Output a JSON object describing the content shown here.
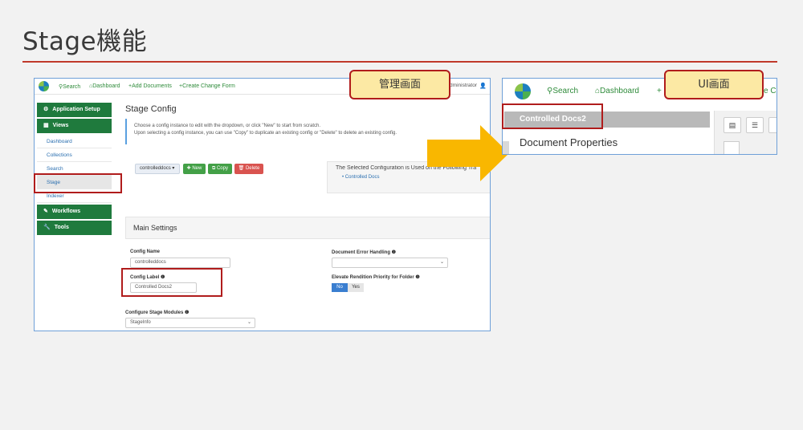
{
  "slide": {
    "title": "Stage機能"
  },
  "callouts": {
    "admin": "管理画面",
    "ui": "UI画面"
  },
  "admin_screen": {
    "nav": {
      "search": "Search",
      "dashboard": "Dashboard",
      "add_documents": "+Add Documents",
      "create_change_form": "+Create Change Form",
      "user": "administrator"
    },
    "sidebar": {
      "application_setup": "Application Setup",
      "views": "Views",
      "items": [
        "Dashboard",
        "Collections",
        "Search",
        "Stage",
        "Indexer"
      ],
      "workflows": "Workflows",
      "tools": "Tools"
    },
    "page_title": "Stage Config",
    "info_line1": "Choose a config instance to edit with the dropdown, or click \"New\" to start from scratch.",
    "info_line2": "Upon selecting a config instance, you can use \"Copy\" to duplicate an existing config or \"Delete\" to delete an existing config.",
    "config_dropdown": "controlleddocs ▾",
    "btn_new": "✚ New",
    "btn_copy": "⧉ Copy",
    "btn_delete": "🗑 Delete",
    "selected_config_heading": "The Selected Configuration is Used on the Following Tra",
    "selected_config_item": "Controlled Docs",
    "main_settings": "Main Settings",
    "config_name_label": "Config Name",
    "config_name_value": "controlleddocs",
    "config_label_label": "Config Label ❶",
    "config_label_value": "Controlled Docs2",
    "doc_error_label": "Document Error Handling ❶",
    "elevate_label": "Elevate Rendition Priority for Folder ❶",
    "toggle_no": "No",
    "toggle_yes": "Yes",
    "stage_modules_label": "Configure Stage Modules ❶",
    "stage_modules_value": "StageInfo"
  },
  "ui_screen": {
    "nav_search": "Search",
    "nav_dashboard": "Dashboard",
    "nav_cut": "e Ch",
    "controlled_docs": "Controlled Docs2",
    "document_properties": "Document Properties"
  },
  "colors": {
    "accent_red": "#b01c1c",
    "callout_yellow": "#fce9a4",
    "arrow": "#f9b700",
    "green": "#1f7a3d"
  }
}
